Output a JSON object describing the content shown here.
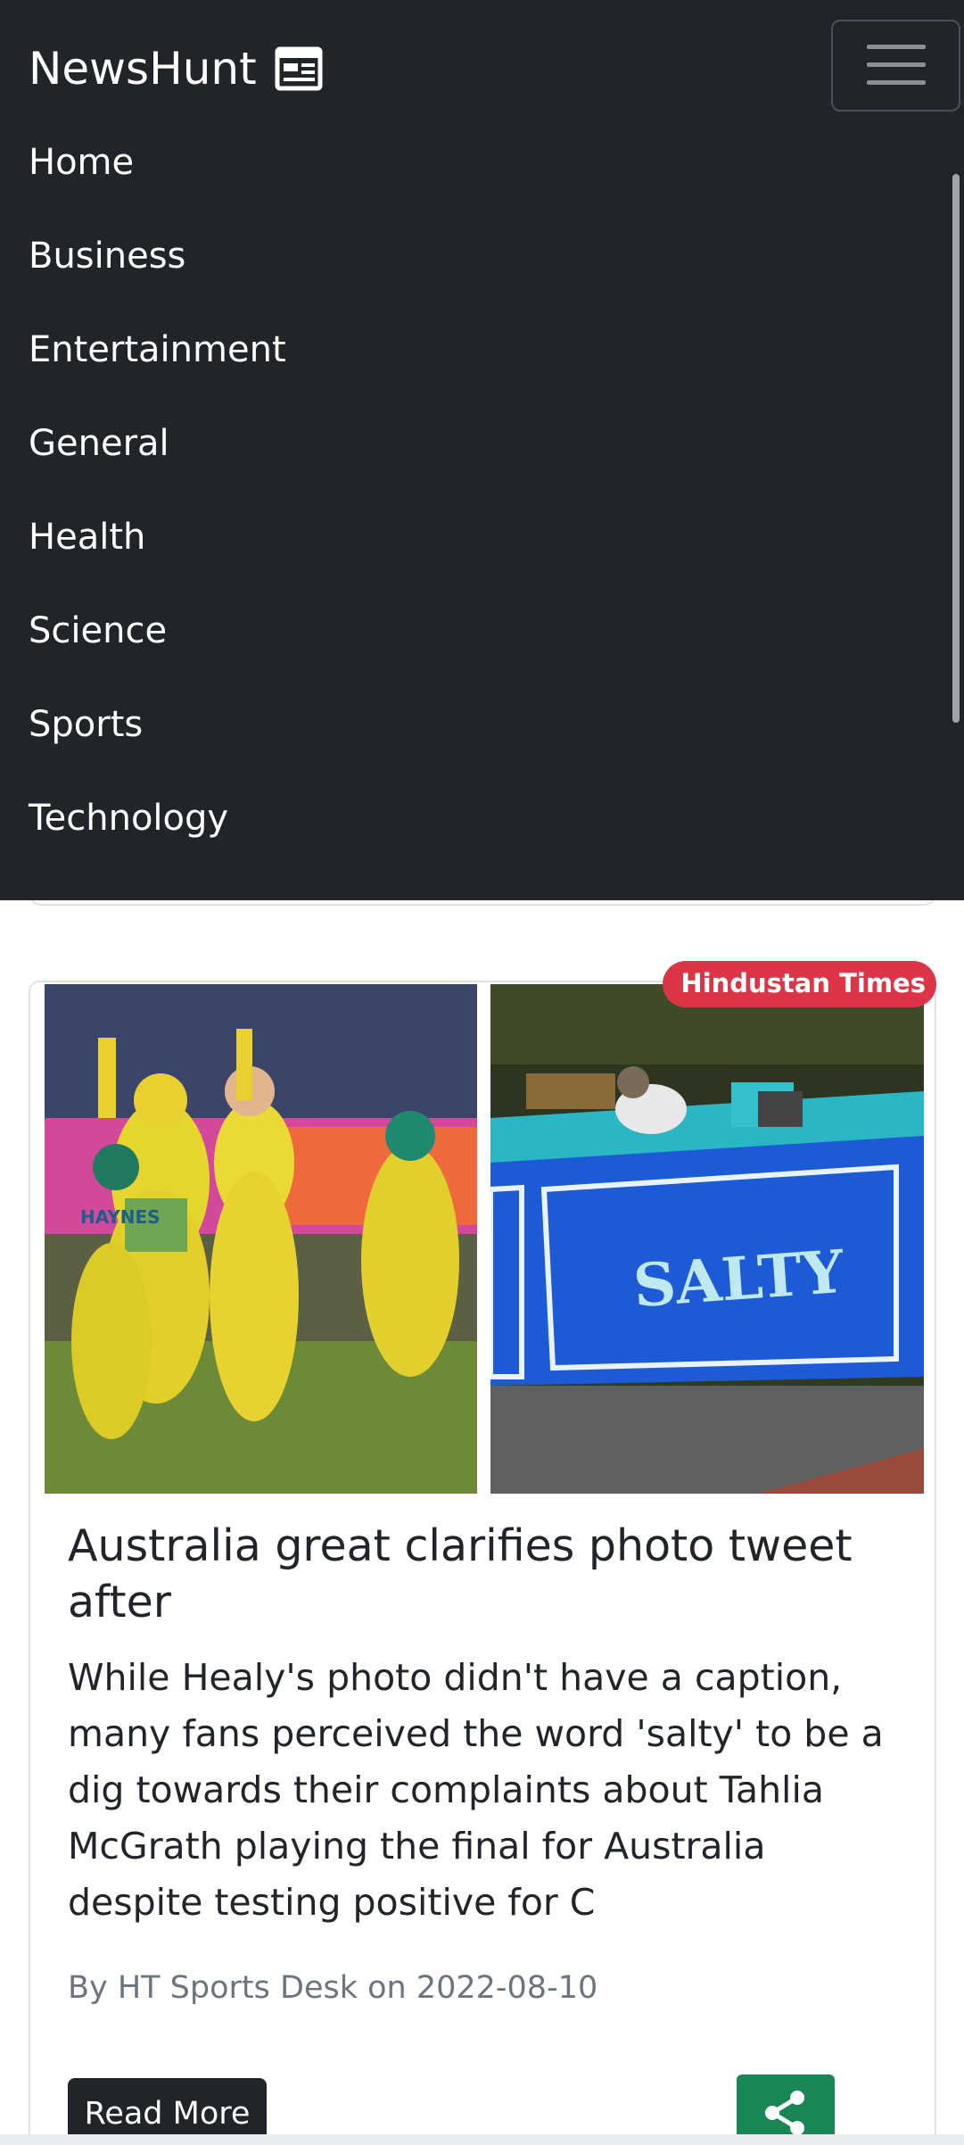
{
  "navbar": {
    "brand": "NewsHunt",
    "brand_icon": "newspaper-icon",
    "toggler_icon": "hamburger-menu-icon",
    "items": [
      {
        "label": "Home"
      },
      {
        "label": "Business"
      },
      {
        "label": "Entertainment"
      },
      {
        "label": "General"
      },
      {
        "label": "Health"
      },
      {
        "label": "Science"
      },
      {
        "label": "Sports"
      },
      {
        "label": "Technology"
      }
    ]
  },
  "article": {
    "source": "Hindustan Times",
    "title": "Australia great clarifies photo tweet after",
    "description": "While Healy's photo didn't have a caption, many fans perceived the word 'salty' to be a dig towards their complaints about Tahlia McGrath playing the final for Australia despite testing positive for C",
    "byline": "By HT Sports Desk on 2022-08-10",
    "read_more_label": "Read More",
    "share_icon": "share-icon",
    "image_boat_text": "SALTY",
    "image_jersey_text": "HAYNES"
  },
  "colors": {
    "navbar_bg": "#212529",
    "badge_bg": "#dc3545",
    "share_bg": "#198754",
    "read_more_bg": "#212529"
  }
}
